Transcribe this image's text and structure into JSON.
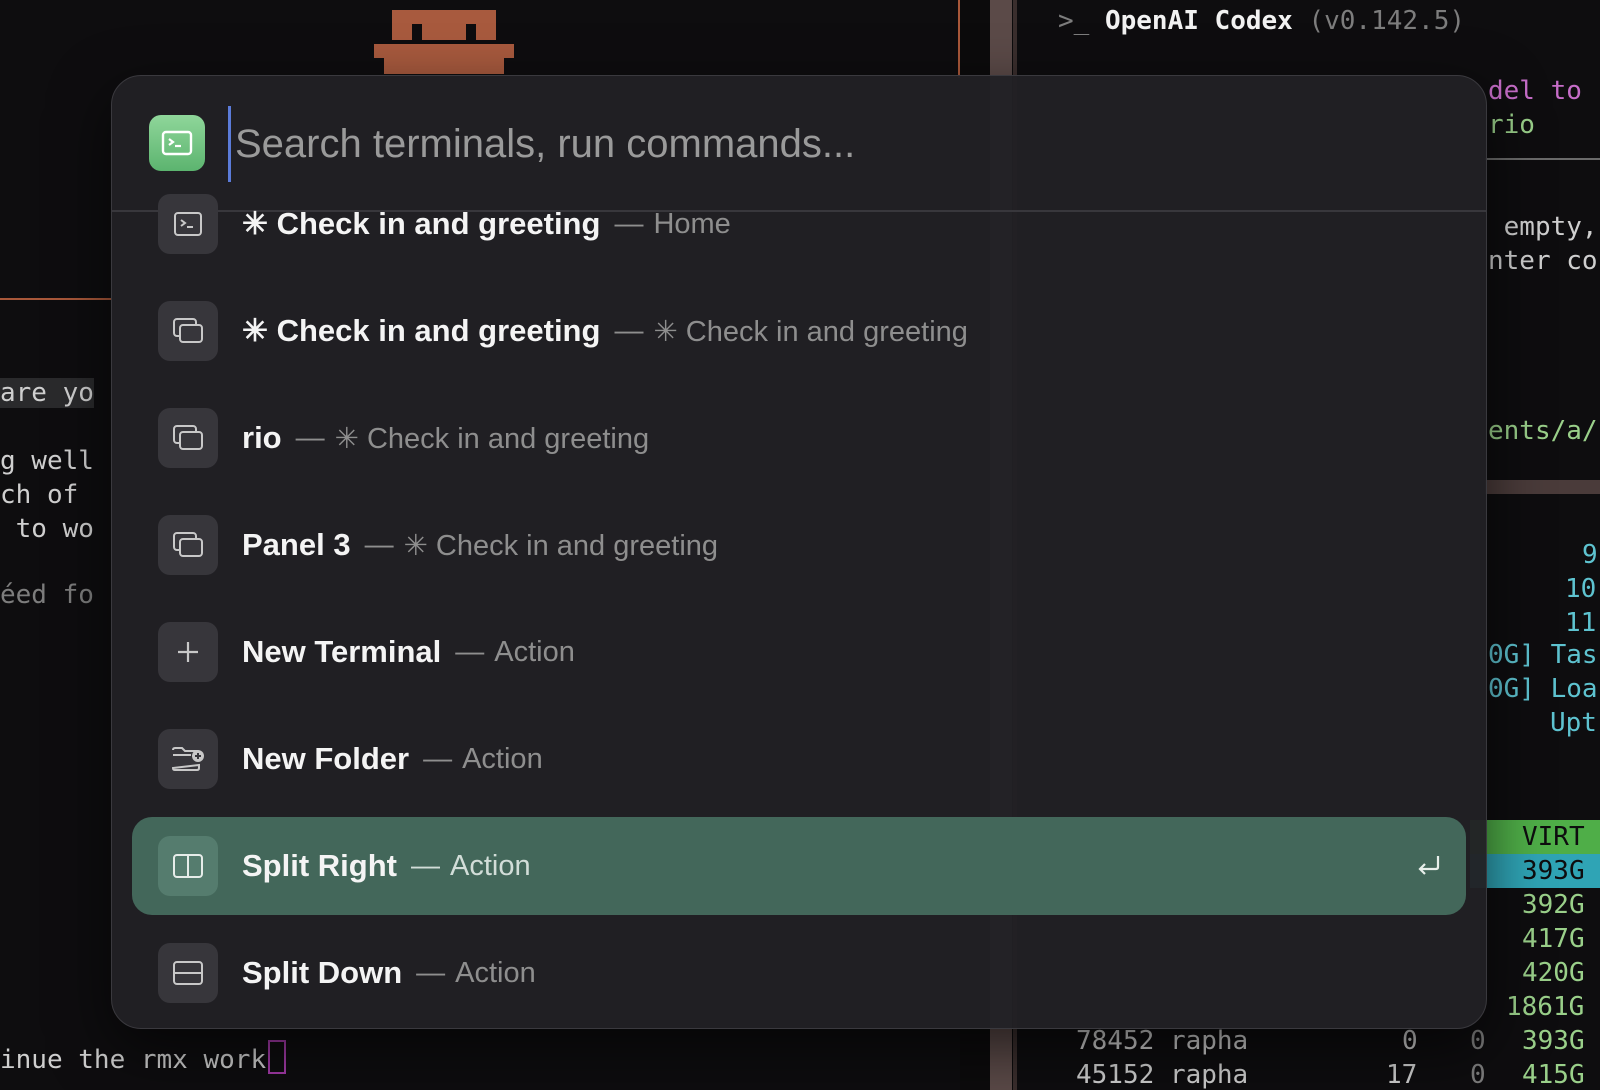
{
  "background": {
    "left_terminal_lines": [
      {
        "text": "are yo"
      },
      {
        "text": "g well"
      },
      {
        "text": "ch of"
      },
      {
        "text": " to wo"
      },
      {
        "text": "éed fo"
      }
    ],
    "bottom_prompt": "inue the rmx work",
    "right_terminal": {
      "title_prefix": ">_",
      "title": "OpenAI Codex",
      "version": "(v0.142.5)",
      "line_model_end": "del to c",
      "line_path_end": "rio",
      "line_tip_end": " empty,",
      "line_enter": "nter co",
      "line_docs": "ents/a/",
      "meter_digits": [
        "9",
        "10",
        "11"
      ],
      "task_labels": [
        "0G] Tas",
        "0G] Loa",
        "Upt"
      ],
      "process_header": "VIRT",
      "process_virt": [
        "393G",
        "392G",
        "417G",
        "420G",
        "1861G",
        "393G",
        "415G"
      ],
      "process_rows": [
        {
          "pid": "78452",
          "user": "rapha",
          "pri": "0",
          "ni": "0",
          "virt": "393G"
        },
        {
          "pid": "45152",
          "user": "rapha",
          "pri": "17",
          "ni": "0",
          "virt": "415G"
        }
      ]
    }
  },
  "palette": {
    "search_placeholder": "Search terminals, run commands...",
    "search_icon": "terminal-icon",
    "items": [
      {
        "icon": "terminal-icon",
        "title": "✳ Check in and greeting",
        "subtitle": "Home",
        "selected": false
      },
      {
        "icon": "tabs-icon",
        "title": "✳ Check in and greeting",
        "subtitle": "✳ Check in and greeting",
        "selected": false
      },
      {
        "icon": "tabs-icon",
        "title": "rio",
        "subtitle": "✳ Check in and greeting",
        "selected": false
      },
      {
        "icon": "tabs-icon",
        "title": "Panel 3",
        "subtitle": "✳ Check in and greeting",
        "selected": false
      },
      {
        "icon": "plus-icon",
        "title": "New Terminal",
        "subtitle": "Action",
        "selected": false
      },
      {
        "icon": "folder-plus-icon",
        "title": "New Folder",
        "subtitle": "Action",
        "selected": false
      },
      {
        "icon": "split-right-icon",
        "title": "Split Right",
        "subtitle": "Action",
        "selected": true
      },
      {
        "icon": "split-down-icon",
        "title": "Split Down",
        "subtitle": "Action",
        "selected": false
      }
    ],
    "separator": "—",
    "enter_icon": "return-icon",
    "colors": {
      "selected_bg": "#43675a",
      "icon_accent": "#6cc07e",
      "panel_bg": "#212024"
    }
  }
}
